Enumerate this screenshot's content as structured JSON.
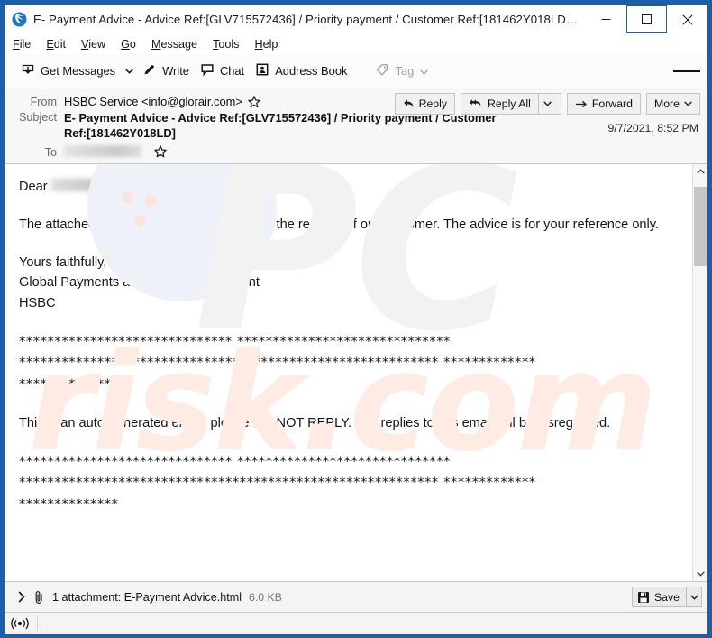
{
  "window": {
    "title": "E- Payment Advice - Advice Ref:[GLV715572436] / Priority payment / Customer Ref:[181462Y018LD…",
    "app_icon": "thunderbird-icon",
    "controls": {
      "minimize": "minimize-icon",
      "maximize": "maximize-icon",
      "close": "close-icon"
    },
    "frame_color": "#1b5faa"
  },
  "menubar": {
    "items": [
      {
        "label": "File",
        "accesskey": "F"
      },
      {
        "label": "Edit",
        "accesskey": "E"
      },
      {
        "label": "View",
        "accesskey": "V"
      },
      {
        "label": "Go",
        "accesskey": "G"
      },
      {
        "label": "Message",
        "accesskey": "M"
      },
      {
        "label": "Tools",
        "accesskey": "T"
      },
      {
        "label": "Help",
        "accesskey": "H"
      }
    ]
  },
  "toolbar": {
    "get_messages": "Get Messages",
    "get_messages_icon": "download-inbox-icon",
    "get_messages_caret": "chevron-down-icon",
    "write": "Write",
    "write_icon": "pencil-icon",
    "chat": "Chat",
    "chat_icon": "speech-bubble-icon",
    "address_book": "Address Book",
    "address_book_icon": "contact-card-icon",
    "tag": "Tag",
    "tag_icon": "tag-icon",
    "tag_caret": "chevron-down-icon",
    "tag_disabled": true,
    "app_menu_icon": "hamburger-menu-icon"
  },
  "message": {
    "from_label": "From",
    "from_value": "HSBC Service <info@glorair.com>",
    "from_star_icon": "star-icon",
    "subject_label": "Subject",
    "subject_value": "E- Payment Advice - Advice Ref:[GLV715572436] / Priority payment / Customer Ref:[181462Y018LD]",
    "to_label": "To",
    "to_value_redacted": true,
    "to_star_icon": "star-icon",
    "date": "9/7/2021, 8:52 PM",
    "actions": {
      "reply": "Reply",
      "reply_icon": "reply-arrow-icon",
      "reply_all": "Reply All",
      "reply_all_icon": "reply-all-arrow-icon",
      "reply_all_caret": "chevron-down-icon",
      "forward": "Forward",
      "forward_icon": "forward-arrow-icon",
      "more": "More",
      "more_caret": "chevron-down-icon"
    }
  },
  "body": {
    "greeting": "Dear",
    "greeting_redacted": true,
    "paragraph_1": "The attached e-payment advice is issued at the request of our customer. The advice is for your reference only.",
    "signoff_1": "Yours faithfully,",
    "signoff_2": "Global Payments and Cash Management",
    "signoff_3": "HSBC",
    "divider_1": "****************************** ******************************\n*********************************************************** *************\n**************",
    "notice": "This is an auto-generated email, please DO NOT REPLY. Any replies to this email will be disregarded.",
    "divider_2": "****************************** ******************************\n*********************************************************** *************\n**************",
    "watermark_primary": "PC",
    "watermark_secondary": "risk.com"
  },
  "scrollbar": {
    "up_icon": "chevron-up-icon",
    "down_icon": "chevron-down-icon"
  },
  "attachment": {
    "expand_icon": "chevron-right-icon",
    "clip_icon": "paperclip-icon",
    "text": "1 attachment: E-Payment Advice.html",
    "size": "6.0 KB",
    "save_label": "Save",
    "save_icon": "save-disk-icon",
    "save_caret": "chevron-down-icon"
  },
  "statusbar": {
    "online_icon": "online-status-icon"
  }
}
